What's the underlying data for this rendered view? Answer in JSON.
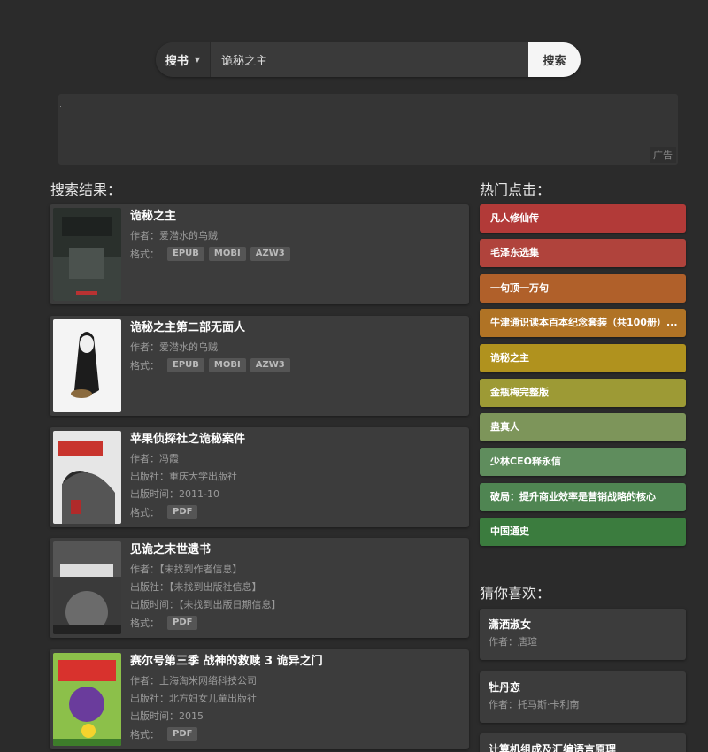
{
  "search": {
    "type_label": "搜书",
    "value": "诡秘之主",
    "button_label": "搜索"
  },
  "ad": {
    "label": "广告"
  },
  "results_title": "搜索结果：",
  "labels": {
    "author": "作者：",
    "publisher": "出版社：",
    "pubdate": "出版时间：",
    "format": "格式："
  },
  "results": [
    {
      "title": "诡秘之主",
      "author": "爱潜水的乌贼",
      "formats": [
        "EPUB",
        "MOBI",
        "AZW3"
      ]
    },
    {
      "title": "诡秘之主第二部无面人",
      "author": "爱潜水的乌贼",
      "formats": [
        "EPUB",
        "MOBI",
        "AZW3"
      ]
    },
    {
      "title": "苹果侦探社之诡秘案件",
      "author": "冯霞",
      "publisher": "重庆大学出版社",
      "pubdate": "2011-10",
      "formats": [
        "PDF"
      ]
    },
    {
      "title": "见诡之末世遗书",
      "author": "【未找到作者信息】",
      "publisher": "【未找到出版社信息】",
      "pubdate": "【未找到出版日期信息】",
      "formats": [
        "PDF"
      ]
    },
    {
      "title": "赛尔号第三季 战神的救赎 3 诡异之门",
      "author": "上海淘米网络科技公司",
      "publisher": "北方妇女儿童出版社",
      "pubdate": "2015",
      "formats": [
        "PDF"
      ]
    }
  ],
  "hot_title": "热门点击：",
  "hot": [
    {
      "label": "凡人修仙传",
      "color": "#b23a38"
    },
    {
      "label": "毛泽东选集",
      "color": "#b0433c"
    },
    {
      "label": "一句顶一万句",
      "color": "#b0602a"
    },
    {
      "label": "牛津通识读本百本纪念套装（共100册）...",
      "color": "#b07325"
    },
    {
      "label": "诡秘之主",
      "color": "#b0921e"
    },
    {
      "label": "金瓶梅完整版",
      "color": "#9d9a35"
    },
    {
      "label": "蛊真人",
      "color": "#7d955a"
    },
    {
      "label": "少林CEO释永信",
      "color": "#5f8d5d"
    },
    {
      "label": "破局：提升商业效率是营销战略的核心",
      "color": "#4f8552"
    },
    {
      "label": "中国通史",
      "color": "#3b7c3e"
    }
  ],
  "guess_title": "猜你喜欢：",
  "guess": [
    {
      "title": "潇洒淑女",
      "author": "唐瑄"
    },
    {
      "title": "牡丹恋",
      "author": "托马斯·卡利南"
    },
    {
      "title": "计算机组成及汇编语言原理",
      "author": ""
    }
  ]
}
